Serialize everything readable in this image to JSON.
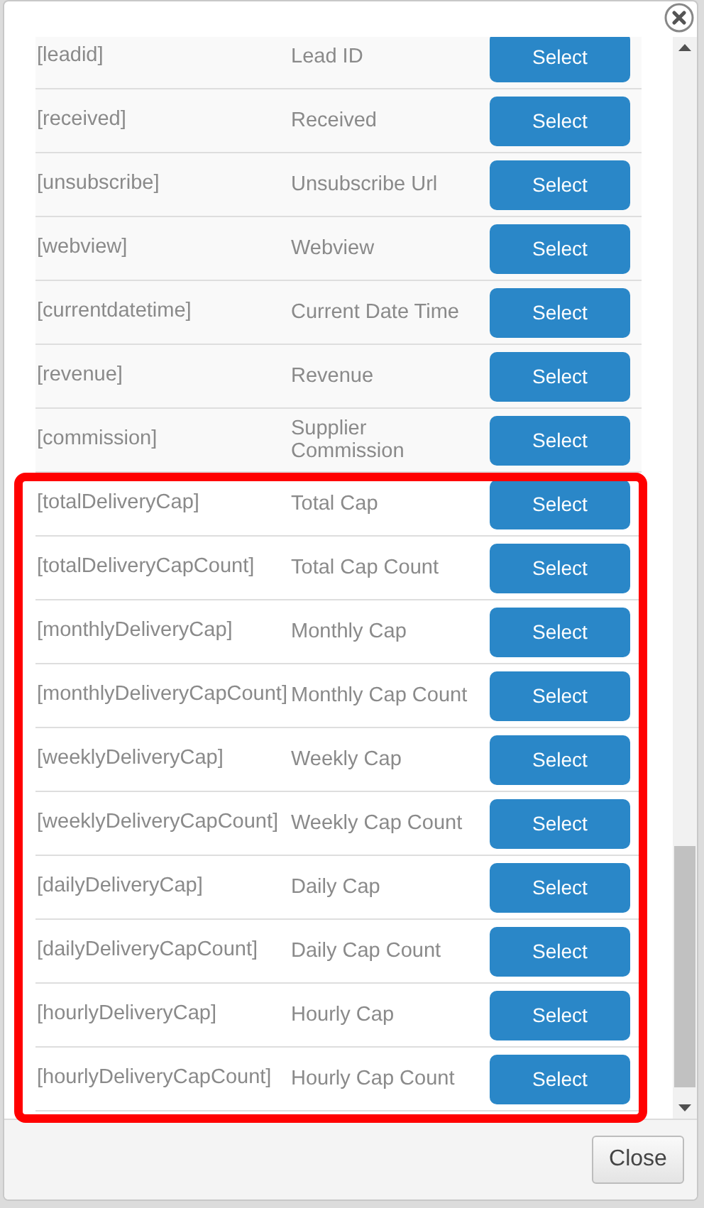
{
  "rows": [
    {
      "key": "[leadid]",
      "label": "Lead ID",
      "button": "Select",
      "highlighted": false
    },
    {
      "key": "[received]",
      "label": "Received",
      "button": "Select",
      "highlighted": false
    },
    {
      "key": "[unsubscribe]",
      "label": "Unsubscribe Url",
      "button": "Select",
      "highlighted": false
    },
    {
      "key": "[webview]",
      "label": "Webview",
      "button": "Select",
      "highlighted": false
    },
    {
      "key": "[currentdatetime]",
      "label": "Current Date Time",
      "button": "Select",
      "highlighted": false
    },
    {
      "key": "[revenue]",
      "label": "Revenue",
      "button": "Select",
      "highlighted": false
    },
    {
      "key": "[commission]",
      "label": "Supplier Commission",
      "button": "Select",
      "highlighted": false
    },
    {
      "key": "[totalDeliveryCap]",
      "label": "Total Cap",
      "button": "Select",
      "highlighted": true
    },
    {
      "key": "[totalDeliveryCapCount]",
      "label": "Total Cap Count",
      "button": "Select",
      "highlighted": true
    },
    {
      "key": "[monthlyDeliveryCap]",
      "label": "Monthly Cap",
      "button": "Select",
      "highlighted": true
    },
    {
      "key": "[monthlyDeliveryCapCount]",
      "label": "Monthly Cap Count",
      "button": "Select",
      "highlighted": true
    },
    {
      "key": "[weeklyDeliveryCap]",
      "label": "Weekly Cap",
      "button": "Select",
      "highlighted": true
    },
    {
      "key": "[weeklyDeliveryCapCount]",
      "label": "Weekly Cap Count",
      "button": "Select",
      "highlighted": true
    },
    {
      "key": "[dailyDeliveryCap]",
      "label": "Daily Cap",
      "button": "Select",
      "highlighted": true
    },
    {
      "key": "[dailyDeliveryCapCount]",
      "label": "Daily Cap Count",
      "button": "Select",
      "highlighted": true
    },
    {
      "key": "[hourlyDeliveryCap]",
      "label": "Hourly Cap",
      "button": "Select",
      "highlighted": true
    },
    {
      "key": "[hourlyDeliveryCapCount]",
      "label": "Hourly Cap Count",
      "button": "Select",
      "highlighted": true
    }
  ],
  "footer": {
    "close_button": "Close"
  }
}
